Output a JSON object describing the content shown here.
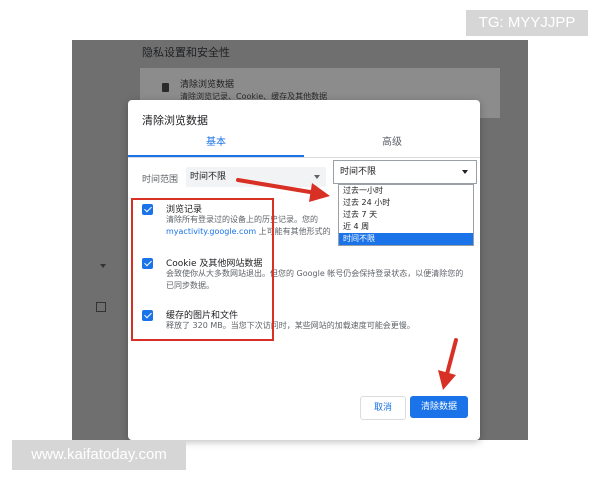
{
  "watermarks": {
    "top": "TG: MYYJJPP",
    "bottom": "www.kaifatoday.com"
  },
  "background": {
    "section_title": "隐私设置和安全性",
    "row_title": "清除浏览数据",
    "row_subtitle": "清除浏览记录、Cookie、缓存及其他数据"
  },
  "dialog": {
    "title": "清除浏览数据",
    "tabs": [
      {
        "label": "基本",
        "active": true
      },
      {
        "label": "高级",
        "active": false
      }
    ],
    "time_range": {
      "label": "时间范围",
      "value": "时间不限"
    },
    "options": [
      {
        "title": "浏览记录",
        "desc": "清除所有登录过的设备上的历史记录。您的",
        "link": "myactivity.google.com",
        "link_suffix": " 上可能有其他形式的",
        "checked": true
      },
      {
        "title": "Cookie 及其他网站数据",
        "desc": "会致使你从大多数网站退出。但您的 Google 帐号仍会保持登录状态，以便清除您的已同步数据。",
        "checked": true
      },
      {
        "title": "缓存的图片和文件",
        "desc": "释放了 320 MB。当您下次访问时，某些网站的加载速度可能会更慢。",
        "checked": true
      }
    ],
    "buttons": {
      "cancel": "取消",
      "clear": "清除数据"
    }
  },
  "dropdown": {
    "selected": "时间不限",
    "options": [
      "过去一小时",
      "过去 24 小时",
      "过去 7 天",
      "近 4 周",
      "时间不限"
    ],
    "selected_index": 4
  },
  "colors": {
    "accent": "#1a73e8",
    "annotation": "#d93025",
    "overlay": "#6f6f6f"
  }
}
